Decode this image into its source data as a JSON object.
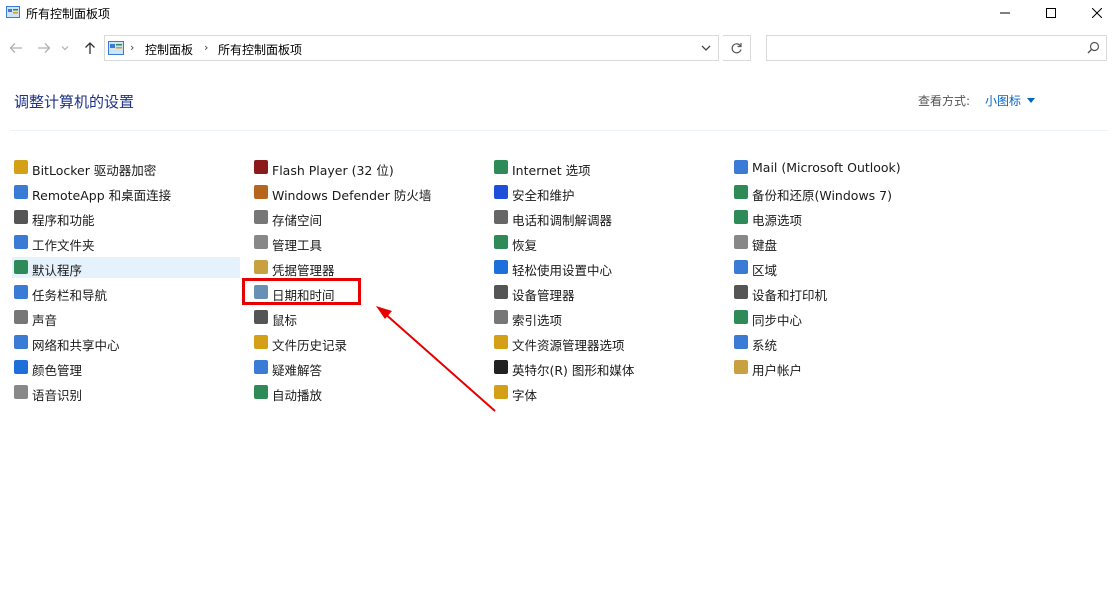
{
  "window": {
    "title": "所有控制面板项"
  },
  "address": {
    "crumbs": [
      "控制面板",
      "所有控制面板项"
    ],
    "search_placeholder": ""
  },
  "header": {
    "heading": "调整计算机的设置",
    "view_by_label": "查看方式:",
    "view_by_value": "小图标"
  },
  "columns": [
    [
      {
        "label": "BitLocker 驱动器加密",
        "icon": "bitlocker-icon",
        "color": "#d4a017"
      },
      {
        "label": "RemoteApp 和桌面连接",
        "icon": "remoteapp-icon",
        "color": "#3a7bd5"
      },
      {
        "label": "程序和功能",
        "icon": "programs-icon",
        "color": "#555555"
      },
      {
        "label": "工作文件夹",
        "icon": "work-folders-icon",
        "color": "#3a7bd5"
      },
      {
        "label": "默认程序",
        "icon": "default-programs-icon",
        "color": "#2e8b57"
      },
      {
        "label": "任务栏和导航",
        "icon": "taskbar-icon",
        "color": "#3a7bd5"
      },
      {
        "label": "声音",
        "icon": "sound-icon",
        "color": "#777777"
      },
      {
        "label": "网络和共享中心",
        "icon": "network-icon",
        "color": "#3a7bd5"
      },
      {
        "label": "颜色管理",
        "icon": "color-management-icon",
        "color": "#1e6fd9"
      },
      {
        "label": "语音识别",
        "icon": "speech-icon",
        "color": "#888888"
      }
    ],
    [
      {
        "label": "Flash Player (32 位)",
        "icon": "flash-icon",
        "color": "#8b1a1a"
      },
      {
        "label": "Windows Defender 防火墙",
        "icon": "firewall-icon",
        "color": "#b5651d"
      },
      {
        "label": "存储空间",
        "icon": "storage-icon",
        "color": "#777777"
      },
      {
        "label": "管理工具",
        "icon": "admin-tools-icon",
        "color": "#888888"
      },
      {
        "label": "凭据管理器",
        "icon": "credential-icon",
        "color": "#c8a040"
      },
      {
        "label": "日期和时间",
        "icon": "clock-icon",
        "color": "#6a8fb5"
      },
      {
        "label": "鼠标",
        "icon": "mouse-icon",
        "color": "#555555"
      },
      {
        "label": "文件历史记录",
        "icon": "file-history-icon",
        "color": "#d4a017"
      },
      {
        "label": "疑难解答",
        "icon": "troubleshoot-icon",
        "color": "#3a7bd5"
      },
      {
        "label": "自动播放",
        "icon": "autoplay-icon",
        "color": "#2e8b57"
      }
    ],
    [
      {
        "label": "Internet 选项",
        "icon": "internet-icon",
        "color": "#2e8b57"
      },
      {
        "label": "安全和维护",
        "icon": "flag-icon",
        "color": "#1e4fd9"
      },
      {
        "label": "电话和调制解调器",
        "icon": "phone-icon",
        "color": "#666666"
      },
      {
        "label": "恢复",
        "icon": "recovery-icon",
        "color": "#2e8b57"
      },
      {
        "label": "轻松使用设置中心",
        "icon": "ease-of-access-icon",
        "color": "#1e6fd9"
      },
      {
        "label": "设备管理器",
        "icon": "device-manager-icon",
        "color": "#555555"
      },
      {
        "label": "索引选项",
        "icon": "indexing-icon",
        "color": "#777777"
      },
      {
        "label": "文件资源管理器选项",
        "icon": "folder-options-icon",
        "color": "#d4a017"
      },
      {
        "label": "英特尔(R) 图形和媒体",
        "icon": "intel-graphics-icon",
        "color": "#222222"
      },
      {
        "label": "字体",
        "icon": "font-icon",
        "color": "#d4a017"
      }
    ],
    [
      {
        "label": "Mail (Microsoft Outlook)",
        "icon": "mail-icon",
        "color": "#3a7bd5"
      },
      {
        "label": "备份和还原(Windows 7)",
        "icon": "backup-icon",
        "color": "#2e8b57"
      },
      {
        "label": "电源选项",
        "icon": "power-icon",
        "color": "#2e8b57"
      },
      {
        "label": "键盘",
        "icon": "keyboard-icon",
        "color": "#888888"
      },
      {
        "label": "区域",
        "icon": "region-icon",
        "color": "#3a7bd5"
      },
      {
        "label": "设备和打印机",
        "icon": "printer-icon",
        "color": "#555555"
      },
      {
        "label": "同步中心",
        "icon": "sync-icon",
        "color": "#2e8b57"
      },
      {
        "label": "系统",
        "icon": "system-icon",
        "color": "#3a7bd5"
      },
      {
        "label": "用户帐户",
        "icon": "user-accounts-icon",
        "color": "#c8a040"
      }
    ]
  ],
  "highlighted_item": "默认程序",
  "annotation": {
    "color": "#e60000"
  }
}
